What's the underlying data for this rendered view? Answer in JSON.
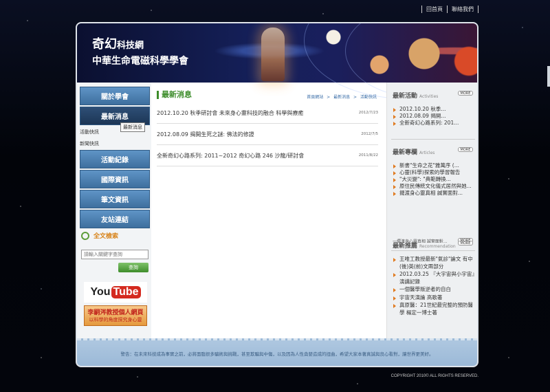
{
  "top_links": [
    "回首頁",
    "聯絡我們"
  ],
  "banner": {
    "title_main": "奇幻",
    "title_suffix": "科技網",
    "subtitle": "中華生命電磁科學學會"
  },
  "left_menu": {
    "items": [
      "關於學會",
      "最新消息",
      "活動紀錄",
      "國際資訊",
      "筆文資訊",
      "友站連結"
    ],
    "submenu": [
      "活動快訊",
      "新聞快訊"
    ],
    "tooltip": "最新消息"
  },
  "search": {
    "title": "全文檢索",
    "placeholder": "請輸入關鍵字查詢",
    "button": "查詢"
  },
  "banners": {
    "youtube_you": "You",
    "youtube_tube": "Tube",
    "prof_line1": "李嗣涔教授個人網頁",
    "prof_line2": "以科學的角度探究身心靈"
  },
  "main": {
    "title": "最新消息",
    "breadcrumb": [
      "首頁網站",
      "最新消息",
      "活動快訊"
    ],
    "news": [
      {
        "title": "2012.10.20 秋季研討會 未來身心靈科技的融合 科學與療癒",
        "date": "2012/7/23"
      },
      {
        "title": "2012.08.09 揭開生死之謎: 佛法的修證",
        "date": "2012/7/5"
      },
      {
        "title": "全新奇幻心路系列: 2011~2012 奇幻心路 246 沙龍/研討會",
        "date": "2011/8/22"
      }
    ]
  },
  "right": {
    "more_label": "MORE",
    "activities": {
      "title": "最新活動",
      "title_en": "Activities",
      "items": [
        "2012.10.20 秋季...",
        "2012.08.09 揭開...",
        "全新奇幻心路系列: 201..."
      ]
    },
    "articles": {
      "title": "最新專欄",
      "title_en": "Articles",
      "items": [
        "新書\"生命之花\"雅萬序 (...",
        "心靈(科學)探索的學習報告",
        "\"大災變\": \"典範轉換...",
        "原住民傳統文化儀式居然與她...",
        "擺渡身心靈真相 誠實面對..."
      ],
      "glitch": "一擺渡身心靈真相 誠實面對..."
    },
    "recommendation": {
      "title": "最新推薦",
      "title_en": "Recommendation",
      "items": [
        "王唯工教授最新\"氣診\"論文 有中(後)英(前)文兩部分",
        "2012.03.25 『大宇宙與小宇宙』演講記錄",
        "一個醫學叛逆者的自白",
        "宇宙天演論 高歌著",
        "真原醫：21世紀最完整的預防醫學 楊定一博士著"
      ]
    }
  },
  "footer": {
    "notice": "警告：在未來科技成為事實之前，必將面臨很多騙術與挑戰，甚至欺騙與中傷，以及因為人性貪婪造成的扭曲，希望大家本著真誠與良心看對，讓世界更美好。"
  },
  "copyright": "COPYRIGHT 2010© ALL RIGHTS RESERVED."
}
